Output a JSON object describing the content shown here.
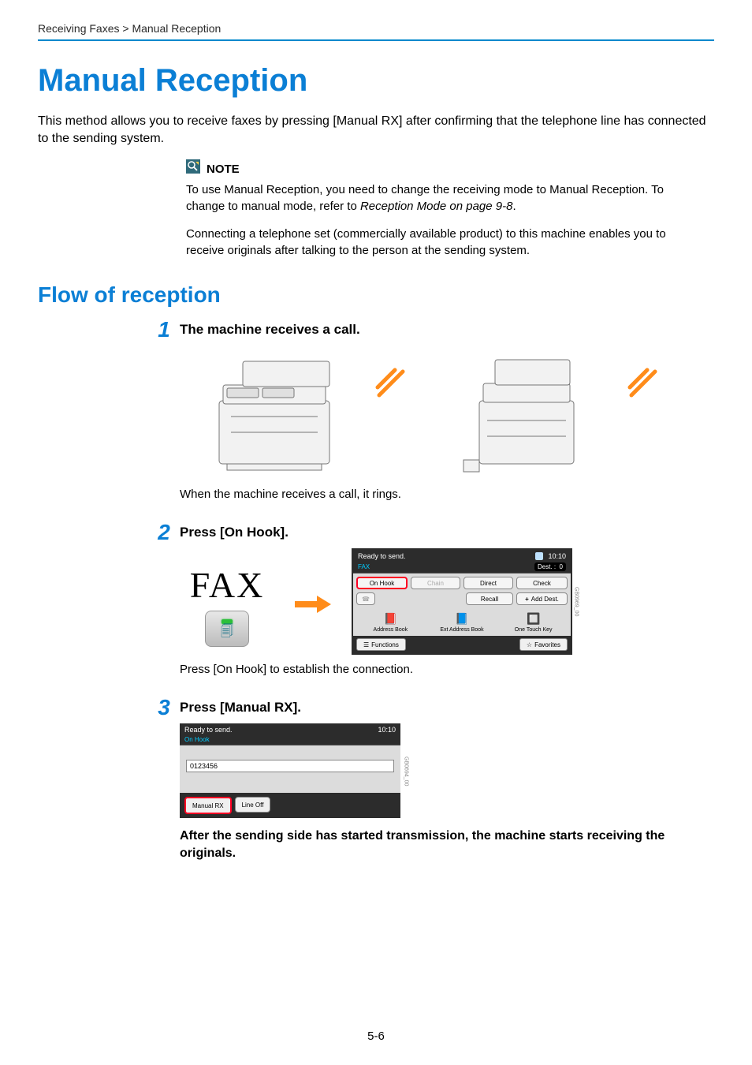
{
  "breadcrumb": "Receiving Faxes > Manual Reception",
  "title": "Manual Reception",
  "intro": "This method allows you to receive faxes by pressing [Manual RX] after confirming that the telephone line has connected to the sending system.",
  "note": {
    "label": "NOTE",
    "paragraph1_a": "To use Manual Reception, you need to change the receiving mode to Manual Reception. To change to manual mode, refer to ",
    "paragraph1_ref": "Reception Mode on page 9-8",
    "paragraph1_b": ".",
    "paragraph2": "Connecting a telephone set (commercially available product) to this machine enables you to receive originals after talking to the person at the sending system."
  },
  "section_flow": "Flow of reception",
  "step1": {
    "num": "1",
    "title": "The machine receives a call.",
    "caption": "When the machine receives a call, it rings."
  },
  "step2": {
    "num": "2",
    "title": "Press [On Hook].",
    "fax_label": "FAX",
    "caption": "Press [On Hook] to establish the connection.",
    "panel": {
      "ready": "Ready to send.",
      "time": "10:10",
      "faxline": "FAX",
      "dest_label": "Dest. :",
      "dest_count": "0",
      "on_hook": "On Hook",
      "chain": "Chain",
      "direct": "Direct",
      "check": "Check",
      "recall": "Recall",
      "add_dest": "Add Dest.",
      "tab_addressbook": "Address Book",
      "tab_ext": "Ext Address Book",
      "tab_onetouch": "One Touch Key",
      "functions": "Functions",
      "favorites": "Favorites",
      "side": "GB0969_00"
    }
  },
  "step3": {
    "num": "3",
    "title": "Press [Manual RX].",
    "panel": {
      "ready": "Ready to send.",
      "time": "10:10",
      "subline": "On Hook",
      "number": "0123456",
      "manual_rx": "Manual RX",
      "line_off": "Line Off",
      "side": "GB0694_00"
    },
    "after": "After the sending side has started transmission, the machine starts receiving the originals."
  },
  "page_number": "5-6"
}
